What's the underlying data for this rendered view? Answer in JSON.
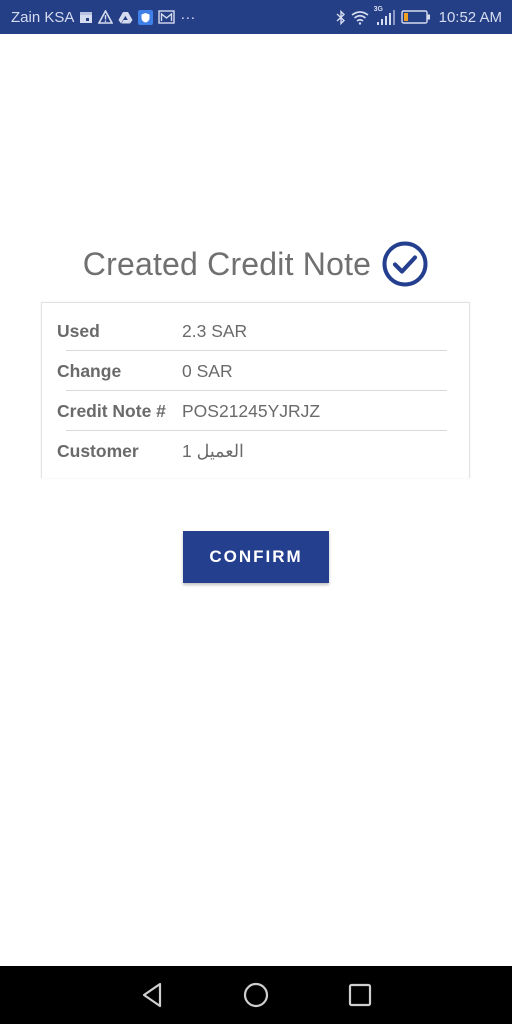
{
  "status_bar": {
    "carrier": "Zain KSA",
    "left_icons": [
      "calendar-icon",
      "warning-icon",
      "drive-icon",
      "shield-icon",
      "mail-icon",
      "more-dots-icon"
    ],
    "more_label": "···",
    "network_label": "3G",
    "right_icons": [
      "bluetooth-icon",
      "wifi-icon",
      "signal-icon",
      "battery-icon"
    ],
    "battery_color": "#f0a020",
    "time": "10:52 AM",
    "background": "#253f86"
  },
  "header": {
    "title": "Created Credit Note",
    "status_icon": "check-circle-icon",
    "accent_color": "#253f8f"
  },
  "details": {
    "rows": [
      {
        "label": "Used",
        "value": "2.3 SAR"
      },
      {
        "label": "Change",
        "value": "0 SAR"
      },
      {
        "label": "Credit Note #",
        "value": "POS21245YJRJZ"
      },
      {
        "label": "Customer",
        "value": "العميل 1"
      }
    ]
  },
  "actions": {
    "confirm_label": "CONFIRM"
  },
  "nav_bar": {
    "buttons": [
      "back-icon",
      "home-icon",
      "recents-icon"
    ]
  }
}
